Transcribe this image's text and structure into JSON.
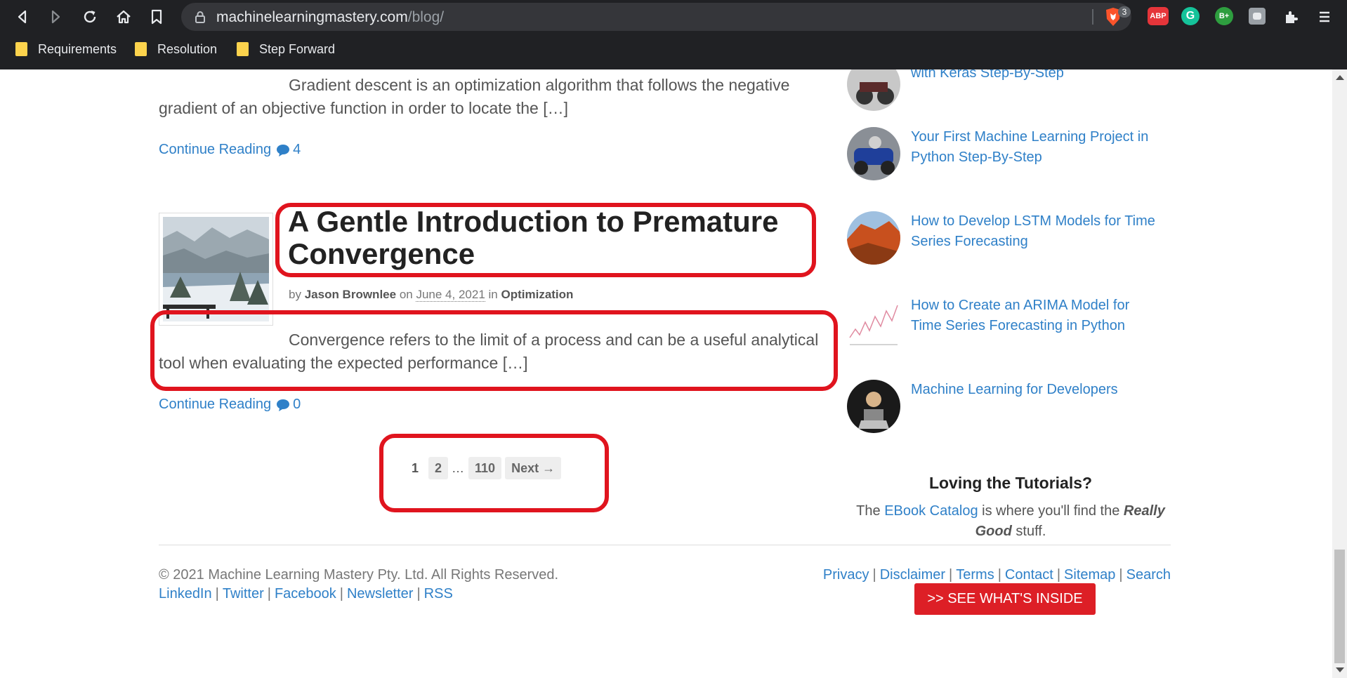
{
  "browser": {
    "url_host": "machinelearningmastery.com",
    "url_path": "/blog/",
    "brave_badge": "3",
    "extensions": [
      {
        "label": "ABP",
        "color": "#e5353a"
      },
      {
        "label": "G",
        "color": "#15c39a"
      },
      {
        "label": "B+",
        "color": "#2e9e3f"
      }
    ],
    "bookmarks": [
      "Requirements",
      "Resolution",
      "Step Forward"
    ]
  },
  "posts": [
    {
      "excerpt": "Gradient descent is an optimization algorithm that follows the negative gradient of an objective function in order to locate the […]",
      "continue_label": "Continue Reading",
      "comment_count": "4"
    },
    {
      "title": "A Gentle Introduction to Premature Convergence",
      "meta_by": "by",
      "author": "Jason Brownlee",
      "meta_on": "on",
      "date": "June 4, 2021",
      "meta_in": "in",
      "category": "Optimization",
      "excerpt": "Convergence refers to the limit of a process and can be a useful analytical tool when evaluating the expected performance […]",
      "continue_label": "Continue Reading",
      "comment_count": "0"
    }
  ],
  "pagination": {
    "current": "1",
    "pages": [
      "2"
    ],
    "ellipsis": "…",
    "last": "110",
    "next": "Next →"
  },
  "sidebar": {
    "popular": [
      {
        "title": "with Keras Step-By-Step"
      },
      {
        "title": "Your First Machine Learning Project in Python Step-By-Step"
      },
      {
        "title": "How to Develop LSTM Models for Time Series Forecasting"
      },
      {
        "title": "How to Create an ARIMA Model for Time Series Forecasting in Python"
      },
      {
        "title": "Machine Learning for Developers"
      }
    ],
    "promo": {
      "heading": "Loving the Tutorials?",
      "text_pre": "The",
      "link": "EBook Catalog",
      "text_mid": "is where you'll find the",
      "emphasis": "Really Good",
      "text_post": "stuff.",
      "button": ">> SEE WHAT'S INSIDE"
    }
  },
  "footer": {
    "copyright": "© 2021 Machine Learning Mastery Pty. Ltd. All Rights Reserved.",
    "social": [
      "LinkedIn",
      "Twitter",
      "Facebook",
      "Newsletter",
      "RSS"
    ],
    "links": [
      "Privacy",
      "Disclaimer",
      "Terms",
      "Contact",
      "Sitemap",
      "Search"
    ],
    "separator": "|"
  },
  "colors": {
    "link": "#2f80c8",
    "highlight": "#e0141e",
    "cta": "#dd1f26"
  }
}
